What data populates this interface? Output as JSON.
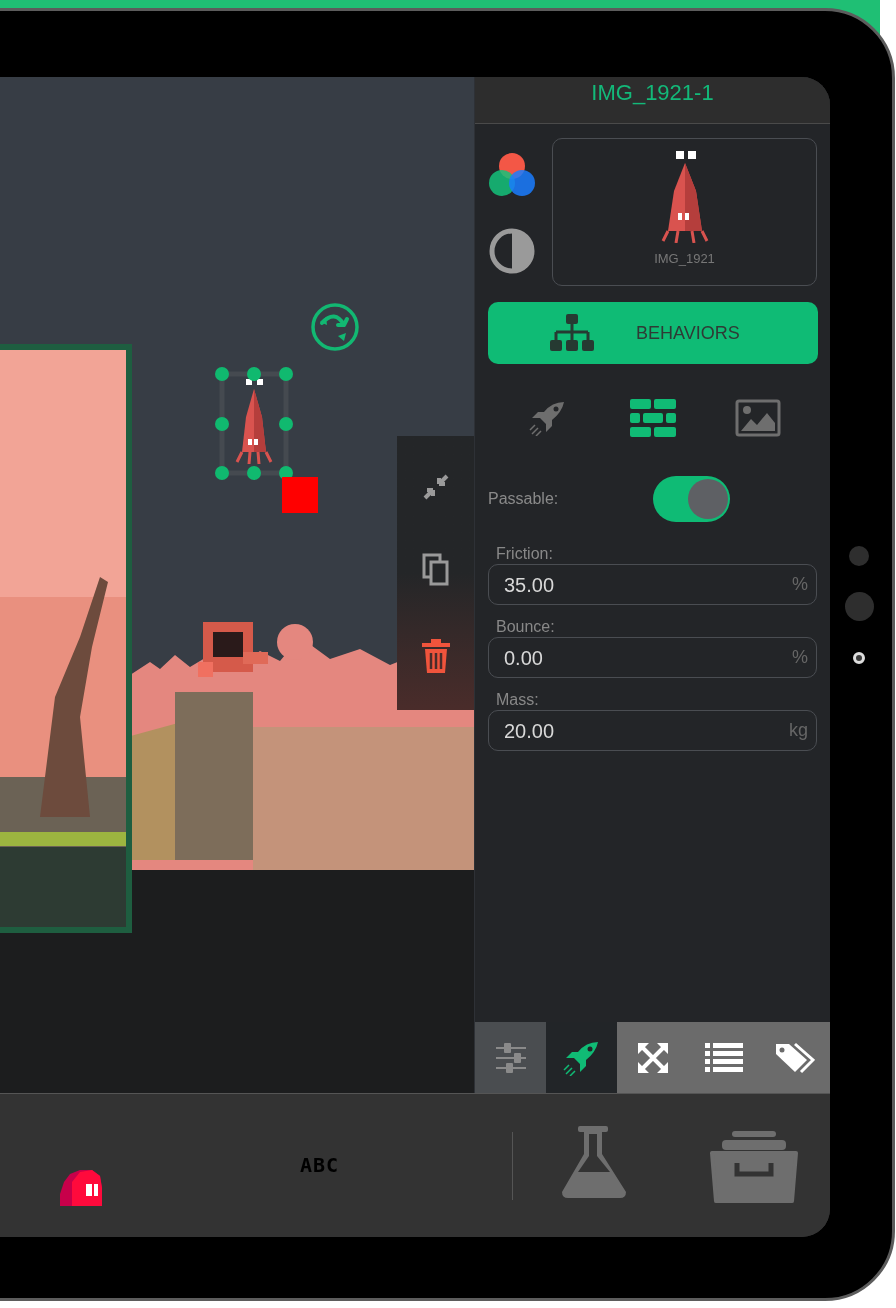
{
  "panel": {
    "title": "IMG_1921-1",
    "asset": {
      "caption": "IMG_1921"
    },
    "behaviors_button": {
      "label": "BEHAVIORS"
    },
    "mode_tabs": [
      {
        "kind": "rocket",
        "selected": false
      },
      {
        "kind": "bricks",
        "selected": true
      },
      {
        "kind": "image",
        "selected": false
      }
    ],
    "passable": {
      "label": "Passable:",
      "on": true
    },
    "fields": [
      {
        "label": "Friction:",
        "value": "35.00",
        "unit": "%"
      },
      {
        "label": "Bounce:",
        "value": "0.00",
        "unit": "%"
      },
      {
        "label": "Mass:",
        "value": "20.00",
        "unit": "kg"
      }
    ],
    "bottom_tabs": [
      {
        "kind": "sliders",
        "selected": false
      },
      {
        "kind": "rocket",
        "selected": true
      },
      {
        "kind": "expand",
        "selected": false
      },
      {
        "kind": "list",
        "selected": false
      },
      {
        "kind": "tags",
        "selected": false
      }
    ]
  },
  "dock": {
    "text_tool": "ABC"
  }
}
